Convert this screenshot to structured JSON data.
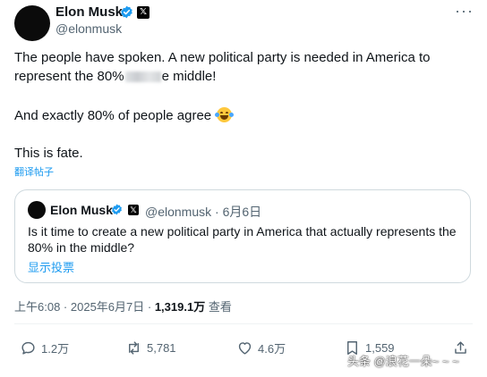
{
  "tweet": {
    "author_name": "Elon Musk",
    "author_handle": "@elonmusk",
    "more_glyph": "···",
    "body": {
      "line1": "The people have spoken. A new political party is needed in America to",
      "line2_start": "represent the 80%",
      "line2_end": "e middle!",
      "line3": "And exactly 80% of people agree",
      "line4": "This is fate."
    },
    "translate_label": "翻译帖子"
  },
  "quoted_tweet": {
    "author_name": "Elon Musk",
    "author_handle": "@elonmusk",
    "separator": "·",
    "date": "6月6日",
    "text_line1": "Is it time to create a new political party in America that actually represents the",
    "text_line2": "80% in the middle?",
    "poll_label": "显示投票"
  },
  "meta": {
    "time": "上午6:08",
    "dot1": " · ",
    "date": "2025年6月7日",
    "dot2": " · ",
    "views_count": "1,319.1万",
    "views_label": " 查看"
  },
  "actions": {
    "replies": "1.2万",
    "reposts": "5,781",
    "likes": "4.6万",
    "bookmarks": "1,559"
  },
  "watermark": "头条 @浪花一朵~ ~ ~",
  "colors": {
    "link": "#1d9bf0",
    "secondary_text": "#536471",
    "verified": "#1d9bf0",
    "border": "#cfd9de"
  },
  "icons": [
    "verified-badge-icon",
    "x-logo-icon",
    "more-icon",
    "reply-icon",
    "repost-icon",
    "like-icon",
    "bookmark-icon",
    "share-icon",
    "grinning-tears-emoji"
  ]
}
